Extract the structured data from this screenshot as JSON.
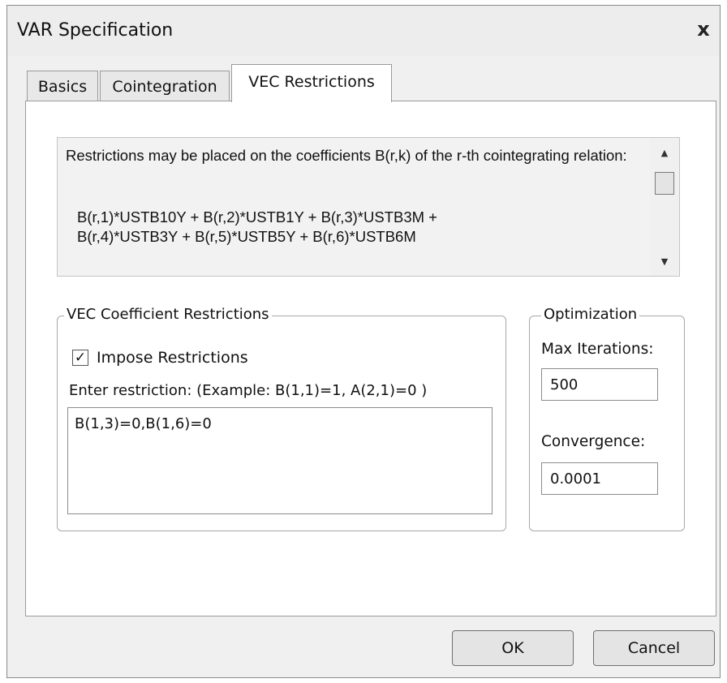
{
  "window": {
    "title": "VAR Specification",
    "close_glyph": "x"
  },
  "tabs": [
    {
      "label": "Basics",
      "active": false
    },
    {
      "label": "Cointegration",
      "active": false
    },
    {
      "label": "VEC Restrictions",
      "active": true
    }
  ],
  "info": {
    "text": "Restrictions may be placed on the coefficients B(r,k) of the r-th cointegrating relation:",
    "formula_line1": "B(r,1)*USTB10Y + B(r,2)*USTB1Y + B(r,3)*USTB3M +",
    "formula_line2": "B(r,4)*USTB3Y + B(r,5)*USTB5Y + B(r,6)*USTB6M",
    "scroll_up_icon": "triangle-up",
    "scroll_down_icon": "triangle-down"
  },
  "vec_restrictions": {
    "legend": "VEC Coefficient Restrictions",
    "impose_label": "Impose Restrictions",
    "impose_checked": true,
    "hint": "Enter restriction:  (Example:  B(1,1)=1, A(2,1)=0 )",
    "value": "B(1,3)=0,B(1,6)=0"
  },
  "optimization": {
    "legend": "Optimization",
    "max_iterations_label": "Max Iterations:",
    "max_iterations_value": "500",
    "convergence_label": "Convergence:",
    "convergence_value": "0.0001"
  },
  "buttons": {
    "ok": "OK",
    "cancel": "Cancel"
  }
}
